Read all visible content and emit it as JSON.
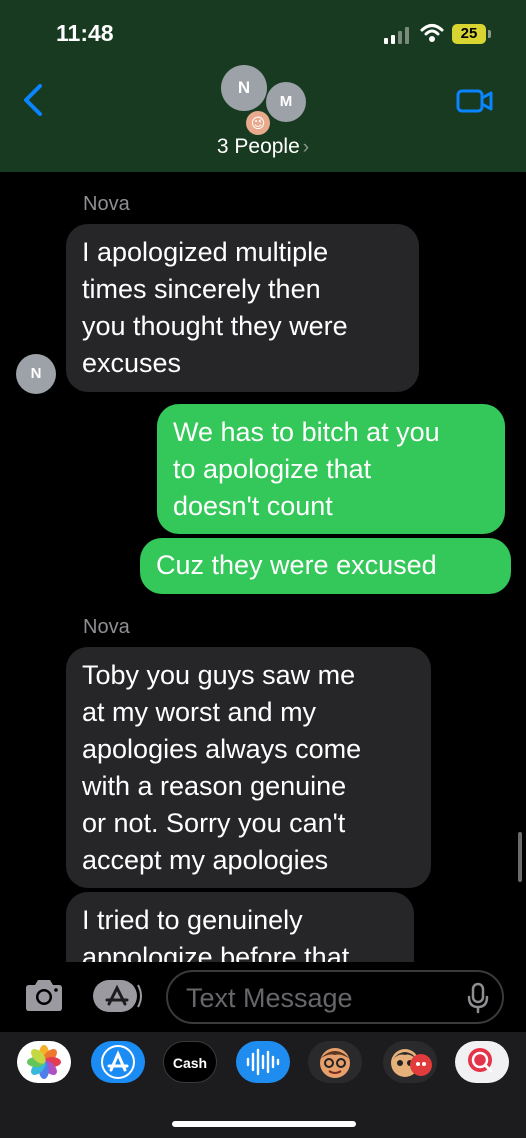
{
  "status": {
    "time": "11:48",
    "battery": "25"
  },
  "header": {
    "avatar_primary": "N",
    "avatar_secondary": "M",
    "avatar_emoji": "😉",
    "group_title": "3 People",
    "title_chevron": "›"
  },
  "messages": [
    {
      "sender": "Nova"
    },
    {
      "text": "I apologized multiple\ntimes sincerely then\nyou thought they were\nexcuses"
    },
    {
      "text": "We has to bitch at you\nto apologize that\ndoesn't count"
    },
    {
      "text": "Cuz they were excused"
    },
    {
      "sender": "Nova"
    },
    {
      "text": "Toby you guys saw me\nat my worst and my\napologies always come\nwith a reason genuine\nor not. Sorry you can't\naccept my apologies"
    },
    {
      "text": "I tried to genuinely\nappologize before that"
    }
  ],
  "thread": {
    "avatar_initial": "N"
  },
  "composer": {
    "placeholder": "Text Message"
  },
  "app_drawer": {
    "cash_label": "Cash",
    "apps": [
      "photos-icon",
      "app-store-icon",
      "apple-cash-icon",
      "audio-message-icon",
      "memoji-icon",
      "animoji-icon",
      "search-images-icon"
    ]
  },
  "colors": {
    "header_bg": "#183a21",
    "outgoing_bubble": "#34c759",
    "incoming_bubble": "#262628",
    "accent_blue": "#0a84ff"
  }
}
